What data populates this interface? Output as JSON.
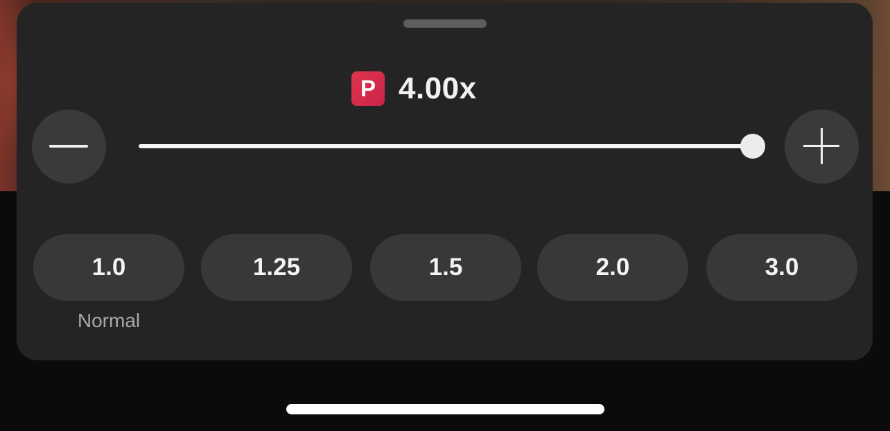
{
  "speed": {
    "premium_badge": "P",
    "current": "4.00x",
    "slider_fraction": 1.0
  },
  "controls": {
    "decrease_icon": "minus-icon",
    "increase_icon": "plus-icon"
  },
  "presets": [
    {
      "label": "1.0",
      "caption": "Normal"
    },
    {
      "label": "1.25"
    },
    {
      "label": "1.5"
    },
    {
      "label": "2.0"
    },
    {
      "label": "3.0"
    }
  ],
  "colors": {
    "sheet": "#242424",
    "button": "#383838",
    "premium": "#d42b4b"
  }
}
